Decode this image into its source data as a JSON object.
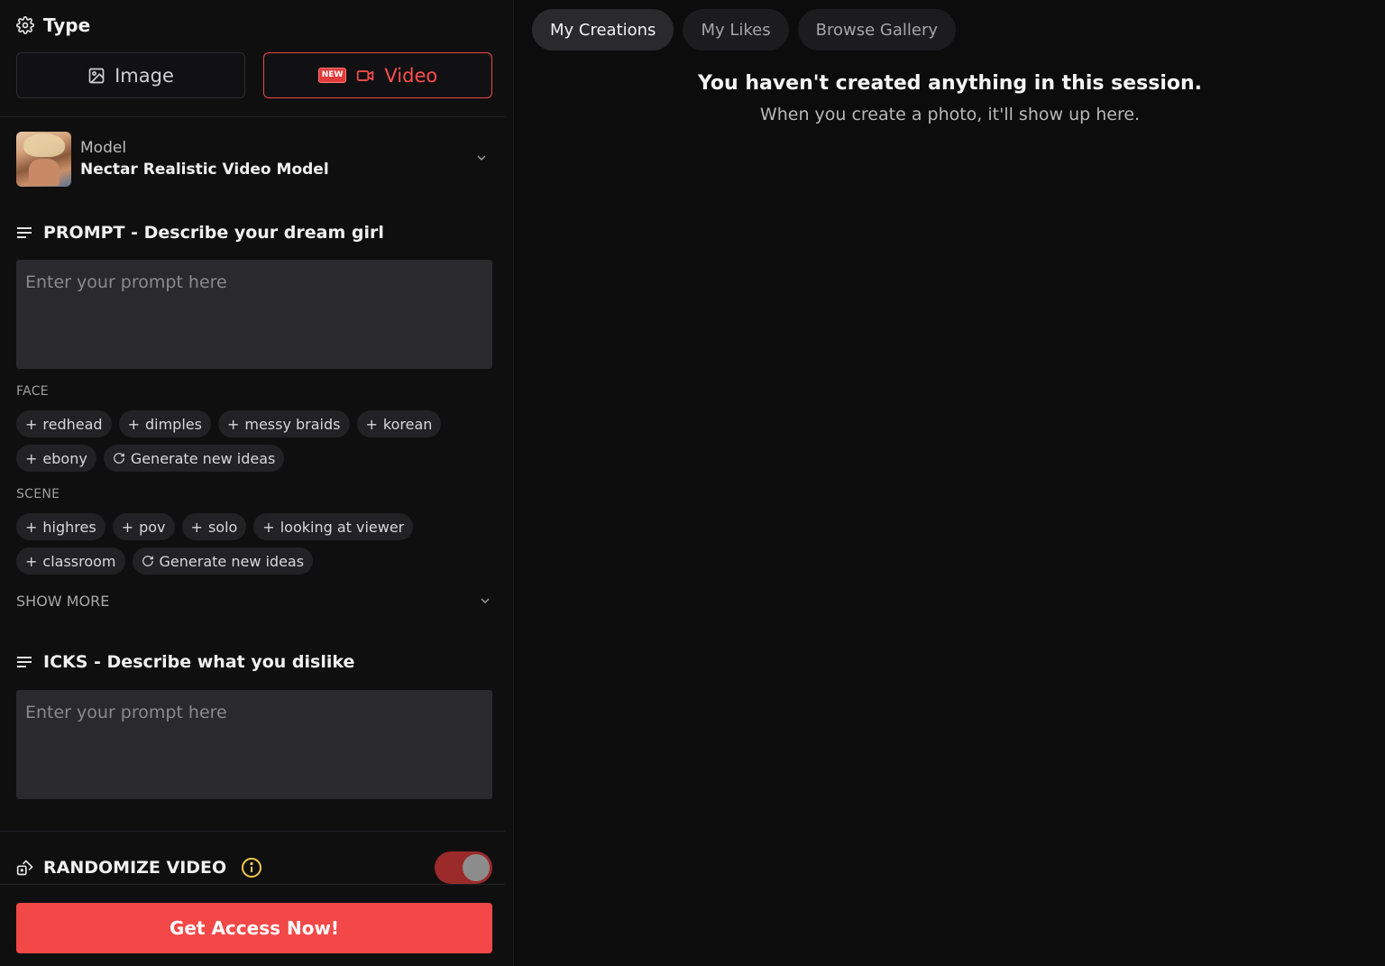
{
  "type_section": {
    "title": "Type",
    "image_label": "Image",
    "video_label": "Video",
    "new_badge": "NEW"
  },
  "model": {
    "label": "Model",
    "name": "Nectar Realistic Video Model"
  },
  "prompt": {
    "title": "PROMPT - Describe your dream girl",
    "placeholder": "Enter your prompt here"
  },
  "face": {
    "label": "FACE",
    "chips": [
      "redhead",
      "dimples",
      "messy braids",
      "korean",
      "ebony"
    ],
    "generate_label": "Generate new ideas"
  },
  "scene": {
    "label": "SCENE",
    "chips": [
      "highres",
      "pov",
      "solo",
      "looking at viewer",
      "classroom"
    ],
    "generate_label": "Generate new ideas"
  },
  "show_more": "SHOW MORE",
  "icks": {
    "title": "ICKS - Describe what you dislike",
    "placeholder": "Enter your prompt here"
  },
  "randomize": {
    "label": "RANDOMIZE VIDEO",
    "enabled": true
  },
  "cta_label": "Get Access Now!",
  "tabs": [
    {
      "label": "My Creations",
      "active": true
    },
    {
      "label": "My Likes",
      "active": false
    },
    {
      "label": "Browse Gallery",
      "active": false
    }
  ],
  "empty_state": {
    "title": "You haven't created anything in this session.",
    "subtitle": "When you create a photo, it'll show up here."
  },
  "colors": {
    "accent": "#f24848",
    "toggle_on": "#9b2a2a",
    "background": "#0c0c0d",
    "input_bg": "#2a2a2c"
  }
}
